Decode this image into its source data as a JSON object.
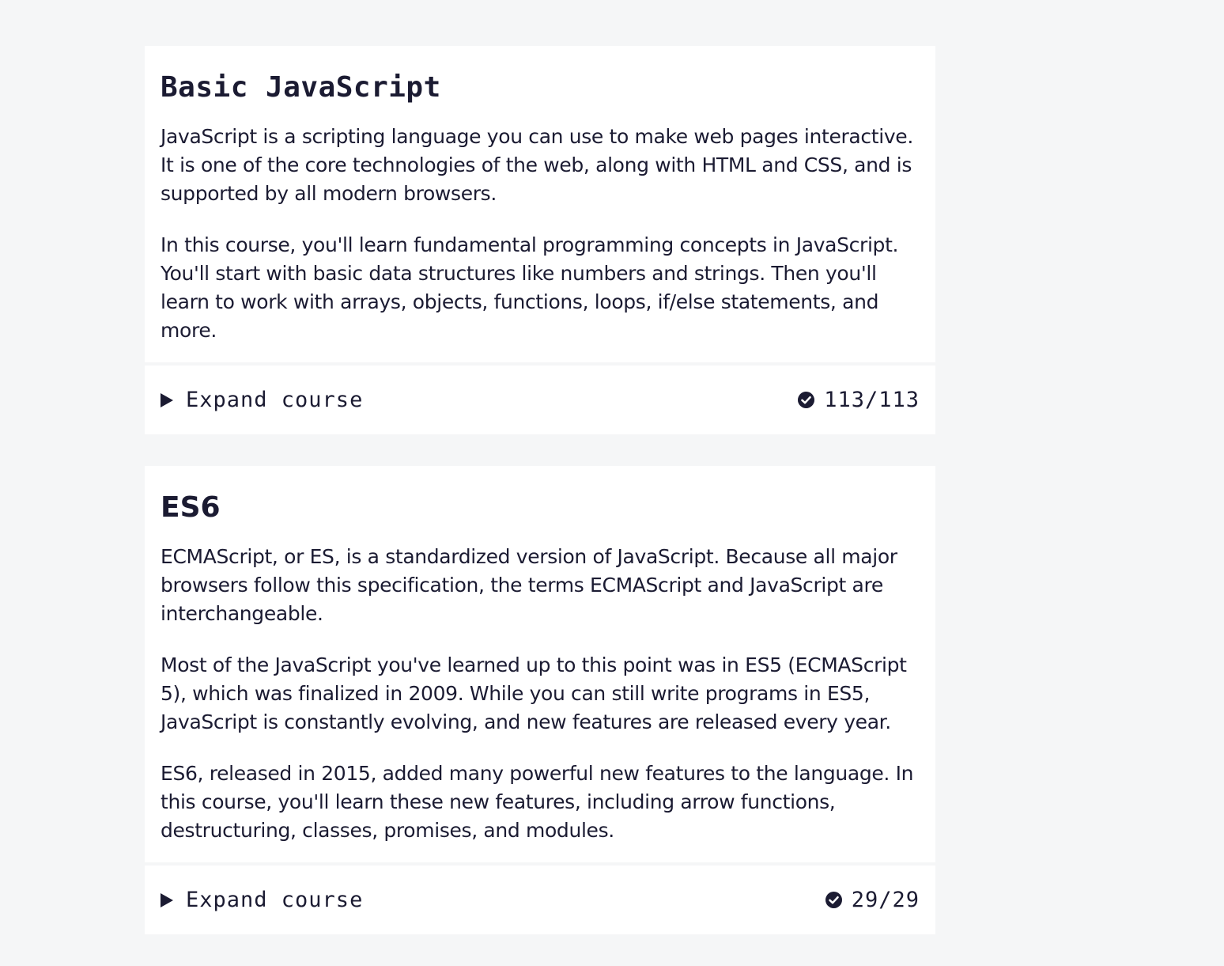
{
  "courses": [
    {
      "title": "Basic JavaScript",
      "description": [
        "JavaScript is a scripting language you can use to make web pages interactive. It is one of the core technologies of the web, along with HTML and CSS, and is supported by all modern browsers.",
        "In this course, you'll learn fundamental programming concepts in JavaScript. You'll start with basic data structures like numbers and strings. Then you'll learn to work with arrays, objects, functions, loops, if/else statements, and more."
      ],
      "expand_label": "Expand course",
      "progress": "113/113",
      "status_icon": "check-circle-icon"
    },
    {
      "title": "ES6",
      "description": [
        "ECMAScript, or ES, is a standardized version of JavaScript. Because all major browsers follow this specification, the terms ECMAScript and JavaScript are interchangeable.",
        "Most of the JavaScript you've learned up to this point was in ES5 (ECMAScript 5), which was finalized in 2009. While you can still write programs in ES5, JavaScript is constantly evolving, and new features are released every year.",
        "ES6, released in 2015, added many powerful new features to the language. In this course, you'll learn these new features, including arrow functions, destructuring, classes, promises, and modules."
      ],
      "expand_label": "Expand course",
      "progress": "29/29",
      "status_icon": "check-circle-icon"
    }
  ],
  "colors": {
    "background": "#f5f6f7",
    "card": "#ffffff",
    "text": "#1b1b32"
  }
}
